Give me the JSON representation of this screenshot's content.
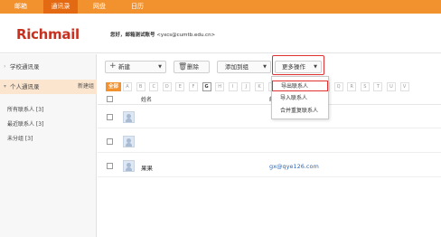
{
  "topnav": {
    "tabs": [
      {
        "label": "邮箱",
        "active": false
      },
      {
        "label": "通讯录",
        "active": true
      },
      {
        "label": "网盘",
        "active": false
      },
      {
        "label": "日历",
        "active": false
      }
    ]
  },
  "header": {
    "logo": "Richmail",
    "greeting_bold": "您好，邮箱测试账号",
    "greeting_email": "<yxcs@cumtb.edu.cn>"
  },
  "sidebar": {
    "groups": [
      {
        "label": "学校通讯录"
      },
      {
        "label": "个人通讯录",
        "new_label": "新建组"
      }
    ],
    "subitems": [
      "所有联系人 [3]",
      "最近联系人 [3]",
      "未分组 [3]"
    ]
  },
  "toolbar": {
    "new_label": "新建",
    "delete_label": "删除",
    "add_to_group_label": "添加到组",
    "more_label": "更多操作"
  },
  "alpha": {
    "all_label": "全部",
    "letters": [
      "A",
      "B",
      "C",
      "D",
      "E",
      "F",
      "G",
      "H",
      "I",
      "J",
      "K",
      "L",
      "M",
      "N",
      "O",
      "P",
      "Q",
      "R",
      "S",
      "T",
      "U",
      "V"
    ]
  },
  "list": {
    "col_name": "姓名",
    "col_email": "邮箱",
    "rows": [
      {
        "name": "",
        "email": ""
      },
      {
        "name": "",
        "email": ""
      },
      {
        "name": "果果",
        "email": "gx@qye126.com"
      }
    ]
  },
  "dropdown": {
    "items": [
      "导出联系人",
      "导入联系人",
      "合并重复联系人"
    ]
  }
}
